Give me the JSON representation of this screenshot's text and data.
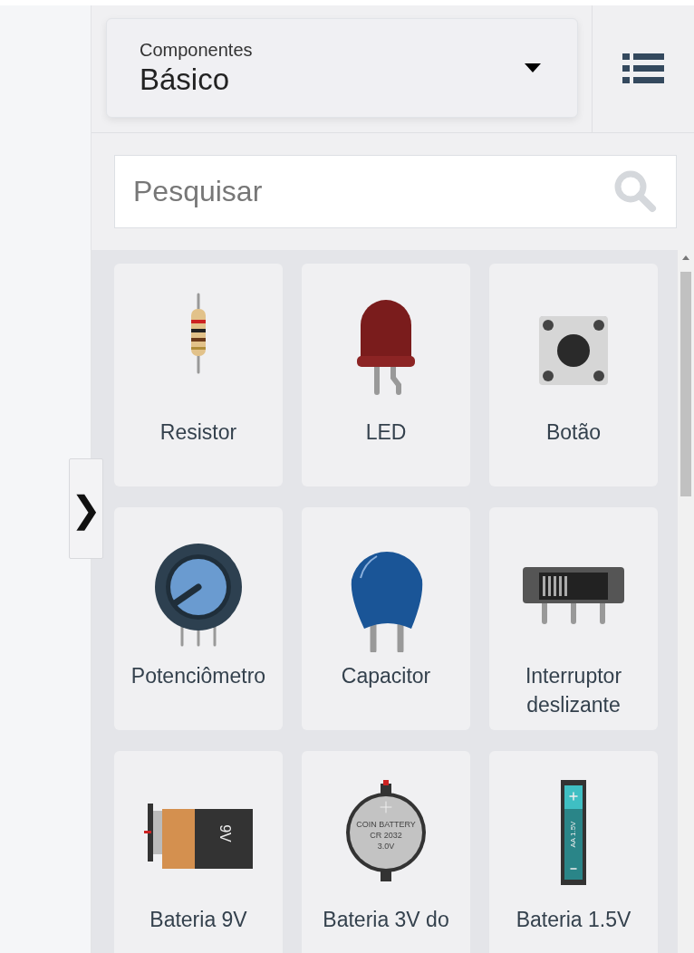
{
  "collapse_toggle": {
    "glyph": "❯"
  },
  "category_dropdown": {
    "label": "Componentes",
    "value": "Básico"
  },
  "search": {
    "placeholder": "Pesquisar"
  },
  "components": [
    {
      "kind": "resistor",
      "label": "Resistor"
    },
    {
      "kind": "led",
      "label": "LED"
    },
    {
      "kind": "pushbutton",
      "label": "Botão"
    },
    {
      "kind": "potentiometer",
      "label": "Potenciômetro"
    },
    {
      "kind": "capacitor",
      "label": "Capacitor"
    },
    {
      "kind": "slide-switch",
      "label": "Interruptor deslizante"
    },
    {
      "kind": "battery-9v",
      "label": "Bateria 9V",
      "markings": [
        "9V"
      ]
    },
    {
      "kind": "coin-battery",
      "label": "Bateria 3V do",
      "markings": [
        "COIN BATTERY",
        "CR 2032",
        "3.0V"
      ]
    },
    {
      "kind": "battery-aa",
      "label": "Bateria 1.5V",
      "markings": [
        "AA 1.5V"
      ]
    }
  ]
}
